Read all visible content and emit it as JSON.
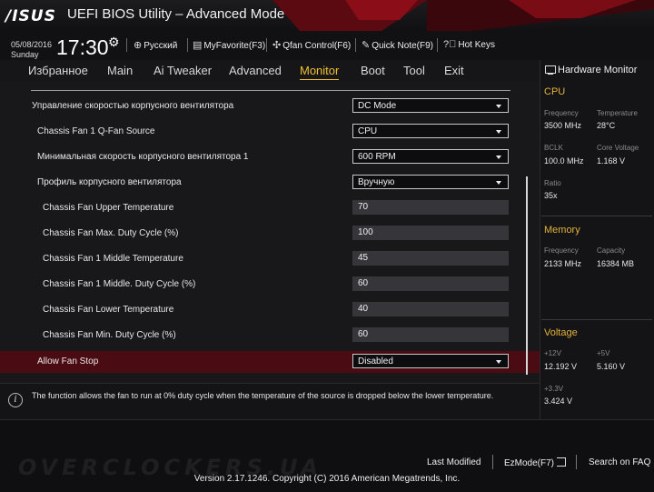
{
  "header": {
    "logo": "/ISUS",
    "title": "UEFI BIOS Utility – Advanced Mode",
    "date": "05/08/2016",
    "day": "Sunday",
    "time": "17:30",
    "buttons": {
      "language": "Русский",
      "myfavorite": "MyFavorite(F3)",
      "qfan": "Qfan Control(F6)",
      "quicknote": "Quick Note(F9)",
      "hotkeys": "Hot Keys"
    }
  },
  "tabs": [
    "Избранное",
    "Main",
    "Ai Tweaker",
    "Advanced",
    "Monitor",
    "Boot",
    "Tool",
    "Exit"
  ],
  "active_tab": "Monitor",
  "settings": [
    {
      "label": "Управление скоростью корпусного вентилятора",
      "value": "DC Mode",
      "type": "dropdown"
    },
    {
      "label": "Chassis Fan 1 Q-Fan Source",
      "value": "CPU",
      "type": "dropdown"
    },
    {
      "label": "Минимальная скорость корпусного вентилятора 1",
      "value": "600 RPM",
      "type": "dropdown"
    },
    {
      "label": "Профиль корпусного вентилятора",
      "value": "Вручную",
      "type": "dropdown"
    },
    {
      "label": "Chassis Fan Upper Temperature",
      "value": "70",
      "type": "number"
    },
    {
      "label": "Chassis Fan Max. Duty Cycle (%)",
      "value": "100",
      "type": "number"
    },
    {
      "label": "Chassis Fan 1 Middle Temperature",
      "value": "45",
      "type": "number"
    },
    {
      "label": "Chassis Fan 1 Middle. Duty Cycle (%)",
      "value": "60",
      "type": "number"
    },
    {
      "label": "Chassis Fan Lower Temperature",
      "value": "40",
      "type": "number"
    },
    {
      "label": "Chassis Fan Min. Duty Cycle (%)",
      "value": "60",
      "type": "number"
    },
    {
      "label": "Allow Fan Stop",
      "value": "Disabled",
      "type": "dropdown",
      "selected": true
    }
  ],
  "help_text": "The function allows the fan to run at 0% duty cycle when the temperature of the source is dropped below the lower temperature.",
  "hardware_monitor": {
    "title": "Hardware Monitor",
    "cpu": {
      "heading": "CPU",
      "frequency_label": "Frequency",
      "frequency": "3500 MHz",
      "temperature_label": "Temperature",
      "temperature": "28°C",
      "bclk_label": "BCLK",
      "bclk": "100.0 MHz",
      "core_voltage_label": "Core Voltage",
      "core_voltage": "1.168 V",
      "ratio_label": "Ratio",
      "ratio": "35x"
    },
    "memory": {
      "heading": "Memory",
      "frequency_label": "Frequency",
      "frequency": "2133 MHz",
      "capacity_label": "Capacity",
      "capacity": "16384 MB"
    },
    "voltage": {
      "heading": "Voltage",
      "v12_label": "+12V",
      "v12": "12.192 V",
      "v5_label": "+5V",
      "v5": "5.160 V",
      "v33_label": "+3.3V",
      "v33": "3.424 V"
    }
  },
  "footer": {
    "last_modified": "Last Modified",
    "ezmode": "EzMode(F7)",
    "search": "Search on FAQ",
    "copyright": "Version 2.17.1246. Copyright (C) 2016 American Megatrends, Inc.",
    "watermark": "OVERCLOCKERS.UA"
  },
  "colors": {
    "accent": "#f0c030",
    "section_heading": "#e3b23c",
    "selected_row": "#4a0b12",
    "brand_red": "#8b0d18"
  },
  "icons": [
    "gear-icon",
    "globe-icon",
    "favorite-icon",
    "fan-icon",
    "note-icon",
    "help-icon",
    "monitor-icon",
    "info-icon",
    "exit-icon"
  ]
}
